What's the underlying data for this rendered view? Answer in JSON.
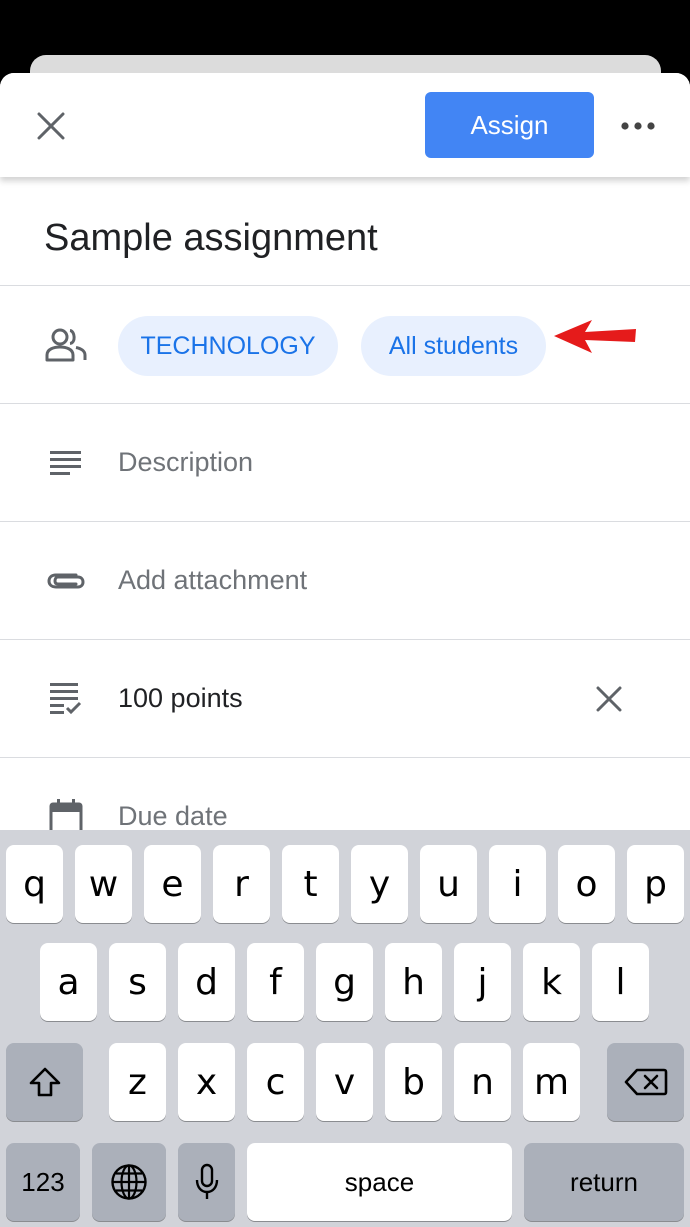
{
  "header": {
    "assign_label": "Assign"
  },
  "assignment": {
    "title": "Sample assignment"
  },
  "audience": {
    "class_chip": "TECHNOLOGY",
    "students_chip": "All students"
  },
  "fields": {
    "description_placeholder": "Description",
    "attachment_placeholder": "Add attachment",
    "points_value": "100 points",
    "due_date_placeholder": "Due date"
  },
  "icons": {
    "close": "close-icon",
    "more": "more-icon",
    "people": "people-icon",
    "description": "description-icon",
    "attachment": "attachment-icon",
    "points": "points-icon",
    "due_date": "calendar-icon",
    "arrow": "red-arrow-icon"
  },
  "colors": {
    "accent": "#4285f4",
    "chip_bg": "#e8f0fe",
    "chip_text": "#1a73e8",
    "annotation_arrow": "#e51b1b"
  },
  "keyboard": {
    "row1": [
      "q",
      "w",
      "e",
      "r",
      "t",
      "y",
      "u",
      "i",
      "o",
      "p"
    ],
    "row2": [
      "a",
      "s",
      "d",
      "f",
      "g",
      "h",
      "j",
      "k",
      "l"
    ],
    "row3": [
      "z",
      "x",
      "c",
      "v",
      "b",
      "n",
      "m"
    ],
    "numbers_label": "123",
    "space_label": "space",
    "return_label": "return"
  }
}
